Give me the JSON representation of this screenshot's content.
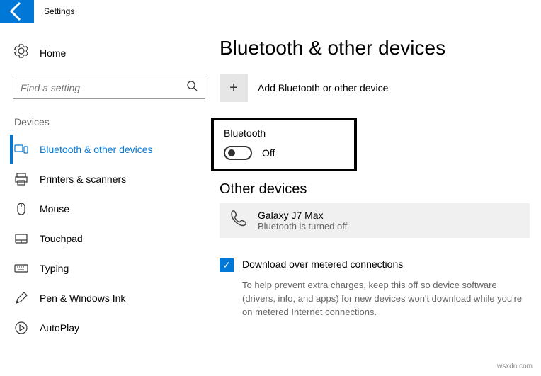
{
  "titlebar": {
    "title": "Settings"
  },
  "sidebar": {
    "home": "Home",
    "search_placeholder": "Find a setting",
    "section": "Devices",
    "items": [
      {
        "label": "Bluetooth & other devices"
      },
      {
        "label": "Printers & scanners"
      },
      {
        "label": "Mouse"
      },
      {
        "label": "Touchpad"
      },
      {
        "label": "Typing"
      },
      {
        "label": "Pen & Windows Ink"
      },
      {
        "label": "AutoPlay"
      }
    ]
  },
  "main": {
    "title": "Bluetooth & other devices",
    "add_label": "Add Bluetooth or other device",
    "bluetooth": {
      "label": "Bluetooth",
      "state": "Off"
    },
    "other_heading": "Other devices",
    "device": {
      "name": "Galaxy J7 Max",
      "status": "Bluetooth is turned off"
    },
    "metered": {
      "label": "Download over metered connections",
      "desc": "To help prevent extra charges, keep this off so device software (drivers, info, and apps) for new devices won't download while you're on metered Internet connections."
    }
  },
  "watermark": "wsxdn.com"
}
